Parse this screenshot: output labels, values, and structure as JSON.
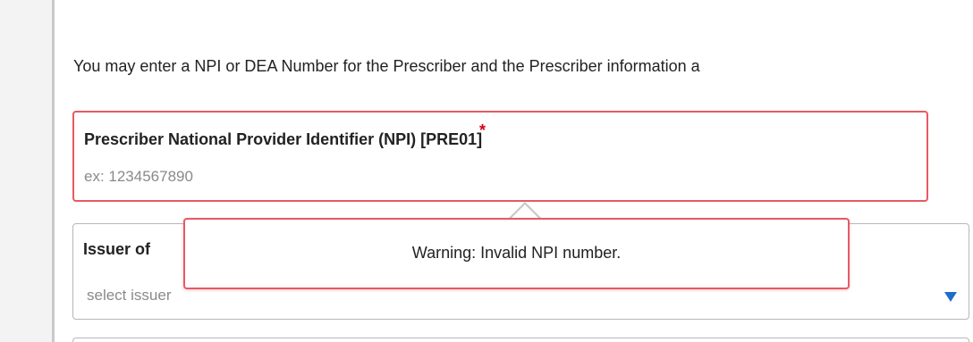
{
  "intro": {
    "text": "You may enter a NPI or DEA Number for the Prescriber and the Prescriber information a"
  },
  "npi_field": {
    "label": "Prescriber National Provider Identifier (NPI) [PRE01]",
    "required_marker": "*",
    "placeholder": "ex: 1234567890",
    "value": ""
  },
  "issuer_field": {
    "label": "Issuer of",
    "placeholder": "select issuer"
  },
  "tooltip": {
    "message": "Warning: Invalid NPI number."
  },
  "colors": {
    "error_border": "#e65a64",
    "required_star": "#d0021b",
    "dropdown_arrow": "#1e6dc8"
  },
  "icons": {
    "dropdown": "triangle-down-icon"
  }
}
